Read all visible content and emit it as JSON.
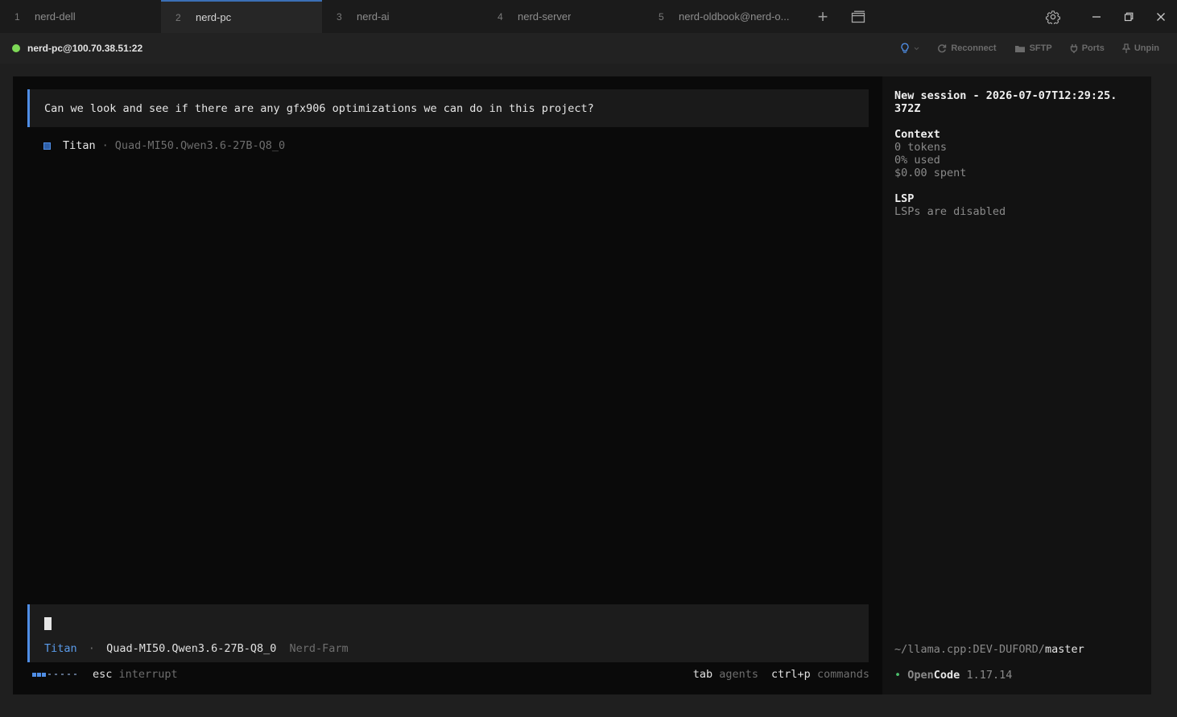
{
  "tabs": [
    {
      "num": "1",
      "name": "nerd-dell"
    },
    {
      "num": "2",
      "name": "nerd-pc"
    },
    {
      "num": "3",
      "name": "nerd-ai"
    },
    {
      "num": "4",
      "name": "nerd-server"
    },
    {
      "num": "5",
      "name": "nerd-oldbook@nerd-o..."
    }
  ],
  "active_tab_index": 1,
  "tab_plus": "+",
  "connection": {
    "host": "nerd-pc@100.70.38.51:22",
    "status_color": "#7ed957",
    "actions": {
      "reconnect": "Reconnect",
      "sftp": "SFTP",
      "ports": "Ports",
      "unpin": "Unpin"
    }
  },
  "conversation": {
    "user_message": "Can we look and see if there are any gfx906 optimizations we can do in this project?",
    "agent": "Titan",
    "separator": "·",
    "model": "Quad-MI50.Qwen3.6-27B-Q8_0"
  },
  "input": {
    "agent": "Titan",
    "separator": "·",
    "model": "Quad-MI50.Qwen3.6-27B-Q8_0",
    "provider": "Nerd-Farm"
  },
  "hints": {
    "esc_key": "esc",
    "esc_label": "interrupt",
    "tab_key": "tab",
    "tab_label": "agents",
    "cmd_key": "ctrl+p",
    "cmd_label": "commands"
  },
  "sidebar": {
    "session_title_line1": "New session - 2026-07-07T12:29:25.",
    "session_title_line2": "372Z",
    "context_title": "Context",
    "tokens": "0 tokens",
    "used": "0% used",
    "spent": "$0.00 spent",
    "lsp_title": "LSP",
    "lsp_status": "LSPs are disabled",
    "path": "~/llama.cpp:DEV-DUFORD/",
    "branch": "master",
    "bullet": "•",
    "app_name_open": "Open",
    "app_name_code": "Code",
    "version": "1.17.14"
  },
  "colors": {
    "accent": "#4f8ee6",
    "agent_blue": "#5a9bea",
    "status_green": "#7ed957"
  }
}
